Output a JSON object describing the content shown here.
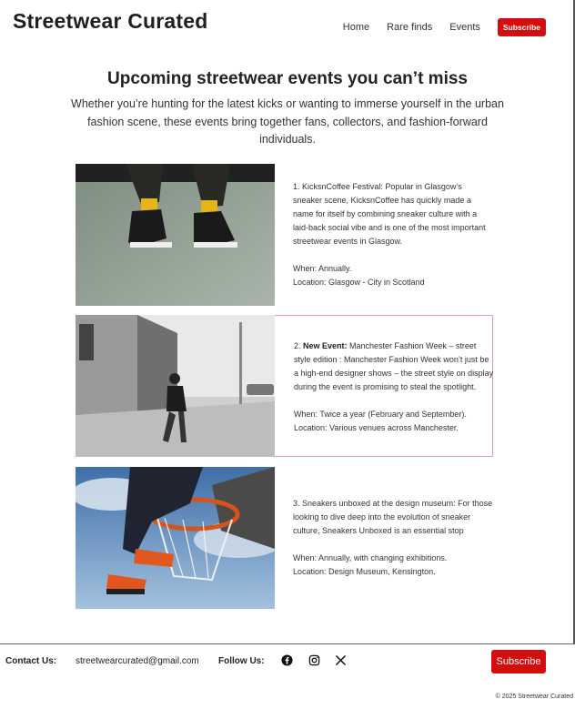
{
  "site": {
    "title": "Streetwear Curated"
  },
  "nav": {
    "items": [
      "Home",
      "Rare finds",
      "Events"
    ],
    "subscribe": "Subscribe"
  },
  "hero": {
    "headline": "Upcoming streetwear events you can’t miss",
    "intro": "Whether you’re hunting for the latest kicks or wanting to immerse yourself in the urban fashion scene, these events bring together fans, collectors, and fashion-forward individuals."
  },
  "events": [
    {
      "desc": "1. KicksnCoffee Festival: Popular in Glasgow’s sneaker scene, KicksnCoffee has quickly made a name for itself by combining sneaker culture with a laid-back social vibe and is one of the most important streetwear events in Glasgow.",
      "when": "When: Annually.",
      "location": "Location: Glasgow - City in Scotland"
    },
    {
      "prefix": "2. ",
      "bold": "New Event:",
      "desc": " Manchester Fashion Week – street style edition : Manchester Fashion Week won’t just be a high-end designer shows – the street style on display during the event is promising to steal the spotlight.",
      "when": "When: Twice a year (February and September).",
      "location": "Location: Various venues across Manchester."
    },
    {
      "desc": "3. Sneakers unboxed at the design museum: For those looking to dive deep into the evolution of sneaker culture, Sneakers Unboxed is an essential stop",
      "when": "When: Annually, with changing exhibitions.",
      "location": "Location: Design Museum, Kensington."
    }
  ],
  "footer": {
    "contact_label": "Contact Us:",
    "email": "streetwearcurated@gmail.com",
    "follow_label": "Follow Us:",
    "social_icons": [
      "facebook-icon",
      "instagram-icon",
      "x-icon"
    ],
    "subscribe": "Subscribe",
    "copyright": "© 2025 Streetwear Curated"
  },
  "colors": {
    "accent": "#d40e0e",
    "highlight_border": "#e79a9a"
  }
}
